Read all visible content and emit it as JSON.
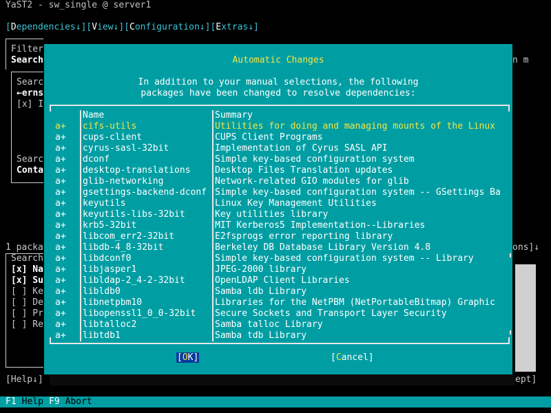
{
  "window": {
    "title": "YaST2 - sw_single @ server1"
  },
  "menubar": {
    "items": [
      {
        "pre": "[",
        "hot": "D",
        "rest": "ependencies↓]"
      },
      {
        "pre": "[",
        "hot": "V",
        "rest": "iew↓]"
      },
      {
        "pre": "[",
        "hot": "C",
        "rest": "onfiguration↓]"
      },
      {
        "pre": "[",
        "hot": "E",
        "rest": "xtras↓]"
      }
    ]
  },
  "background": {
    "filter_label": "Filter",
    "search_label": "Search",
    "search_field_label": "Searc",
    "search_value": "←erns",
    "search_check": "[x] I",
    "search_in_label": "Searc",
    "contains_label": "Conta",
    "package_count": "1 packa",
    "right_hint_top": "n m",
    "right_hint_bottom": "ons]↓",
    "search_in_group": "Search",
    "options": [
      "[x] Na",
      "[x] Su",
      "[ ] Ke",
      "[ ] De",
      "[ ] Pr",
      "[ ] Re"
    ],
    "help_button": "[Help↓]",
    "accept_button": "ept]"
  },
  "dialog": {
    "title": "Automatic Changes",
    "message_line1": "In addition to your manual selections, the following",
    "message_line2": "packages have been changed to resolve dependencies:",
    "table": {
      "headers": {
        "name": "Name",
        "summary": "Summary"
      },
      "rows": [
        {
          "status": "a+",
          "name": "cifs-utils",
          "summary": "Utilities for doing and managing mounts of the Linux"
        },
        {
          "status": "a+",
          "name": "cups-client",
          "summary": "CUPS Client Programs"
        },
        {
          "status": "a+",
          "name": "cyrus-sasl-32bit",
          "summary": "Implementation of Cyrus SASL API"
        },
        {
          "status": "a+",
          "name": "dconf",
          "summary": "Simple key-based configuration system"
        },
        {
          "status": "a+",
          "name": "desktop-translations",
          "summary": "Desktop Files Translation updates"
        },
        {
          "status": "a+",
          "name": "glib-networking",
          "summary": "Network-related GIO modules for glib"
        },
        {
          "status": "a+",
          "name": "gsettings-backend-dconf",
          "summary": "Simple key-based configuration system -- GSettings Ba"
        },
        {
          "status": "a+",
          "name": "keyutils",
          "summary": "Linux Key Management Utilities"
        },
        {
          "status": "a+",
          "name": "keyutils-libs-32bit",
          "summary": "Key utilities library"
        },
        {
          "status": "a+",
          "name": "krb5-32bit",
          "summary": "MIT Kerberos5 Implementation--Libraries"
        },
        {
          "status": "a+",
          "name": "libcom_err2-32bit",
          "summary": "E2fsprogs error reporting library"
        },
        {
          "status": "a+",
          "name": "libdb-4_8-32bit",
          "summary": "Berkeley DB Database Library Version 4.8"
        },
        {
          "status": "a+",
          "name": "libdconf0",
          "summary": "Simple key-based configuration system -- Library"
        },
        {
          "status": "a+",
          "name": "libjasper1",
          "summary": "JPEG-2000 library"
        },
        {
          "status": "a+",
          "name": "libldap-2_4-2-32bit",
          "summary": "OpenLDAP Client Libraries"
        },
        {
          "status": "a+",
          "name": "libldb0",
          "summary": "Samba ldb Library"
        },
        {
          "status": "a+",
          "name": "libnetpbm10",
          "summary": "Libraries for the NetPBM (NetPortableBitmap) Graphic"
        },
        {
          "status": "a+",
          "name": "libopenssl1_0_0-32bit",
          "summary": "Secure Sockets and Transport Layer Security"
        },
        {
          "status": "a+",
          "name": "libtalloc2",
          "summary": "Samba talloc Library"
        },
        {
          "status": "a+",
          "name": "libtdb1",
          "summary": "Samba tdb Library"
        }
      ]
    },
    "ok_button": {
      "pre": "[",
      "hot": "O",
      "rest": "K]"
    },
    "cancel_button": {
      "pre": "[",
      "hot": "C",
      "rest": "ancel]"
    }
  },
  "statusbar": {
    "keys": [
      {
        "key": "F1",
        "label": "Help"
      },
      {
        "key": "F9",
        "label": "Abort"
      }
    ]
  },
  "colors": {
    "dialog_bg": "#009ea3",
    "highlight": "#f5e642",
    "ok_button_bg": "#0a3a9a",
    "menu_text": "#3ec3d6"
  }
}
